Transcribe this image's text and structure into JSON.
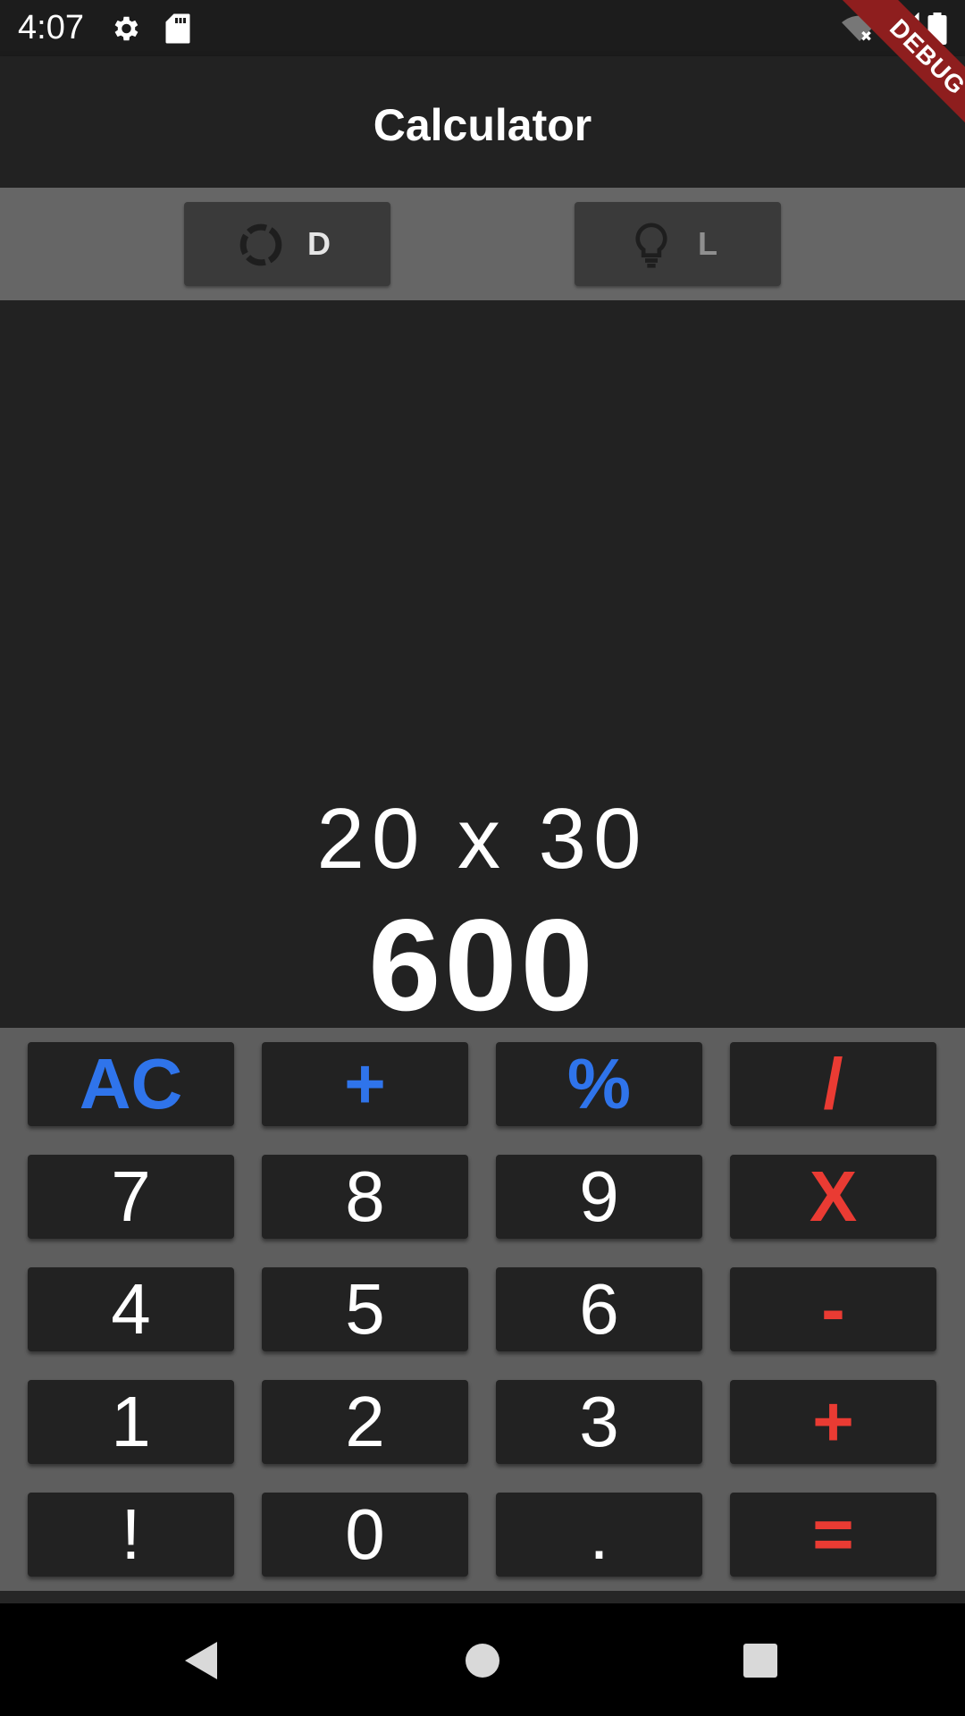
{
  "status_bar": {
    "time": "4:07",
    "icons": [
      "gear-icon",
      "sd-card-icon",
      "wifi-off-icon",
      "signal-off-icon",
      "battery-icon"
    ]
  },
  "debug_banner": "DEBUG",
  "app_bar": {
    "title": "Calculator"
  },
  "theme_toggle": {
    "dark": {
      "label": "D",
      "icon": "dark-mode-icon"
    },
    "light": {
      "label": "L",
      "icon": "lightbulb-icon"
    }
  },
  "display": {
    "expression": "20 x 30",
    "result": "600"
  },
  "keypad": {
    "rows": [
      [
        {
          "label": "AC",
          "style": "blue"
        },
        {
          "label": "+",
          "style": "blue"
        },
        {
          "label": "%",
          "style": "blue"
        },
        {
          "label": "/",
          "style": "red"
        }
      ],
      [
        {
          "label": "7",
          "style": "digit"
        },
        {
          "label": "8",
          "style": "digit"
        },
        {
          "label": "9",
          "style": "digit"
        },
        {
          "label": "X",
          "style": "red"
        }
      ],
      [
        {
          "label": "4",
          "style": "digit"
        },
        {
          "label": "5",
          "style": "digit"
        },
        {
          "label": "6",
          "style": "digit"
        },
        {
          "label": "-",
          "style": "red"
        }
      ],
      [
        {
          "label": "1",
          "style": "digit"
        },
        {
          "label": "2",
          "style": "digit"
        },
        {
          "label": "3",
          "style": "digit"
        },
        {
          "label": "+",
          "style": "red"
        }
      ],
      [
        {
          "label": "!",
          "style": "digit"
        },
        {
          "label": "0",
          "style": "digit"
        },
        {
          "label": ".",
          "style": "digit"
        },
        {
          "label": "=",
          "style": "red"
        }
      ]
    ]
  },
  "colors": {
    "accent_blue": "#2f74eb",
    "accent_red": "#ea3b33",
    "background": "#222222",
    "keypad_bg": "#5e5e5e"
  },
  "nav_bar": [
    "back-icon",
    "home-icon",
    "recents-icon"
  ]
}
